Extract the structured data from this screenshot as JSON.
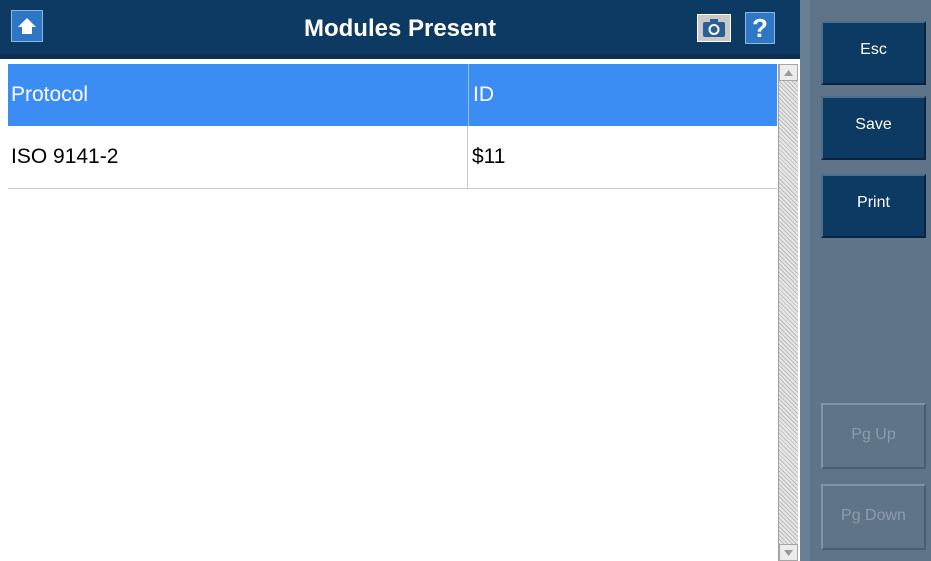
{
  "header": {
    "title": "Modules Present",
    "home_icon": "home-icon",
    "camera_icon": "camera-icon",
    "help_label": "?"
  },
  "table": {
    "columns": [
      "Protocol",
      "ID"
    ],
    "rows": [
      {
        "protocol": "ISO 9141-2",
        "id": "$11"
      }
    ]
  },
  "sidebar": {
    "esc_label": "Esc",
    "save_label": "Save",
    "print_label": "Print",
    "pgup_label": "Pg Up",
    "pgdown_label": "Pg Down"
  },
  "colors": {
    "header_bg": "#0d3a63",
    "table_header_bg": "#3b8cf3",
    "side_panel_bg": "#5f7488"
  }
}
